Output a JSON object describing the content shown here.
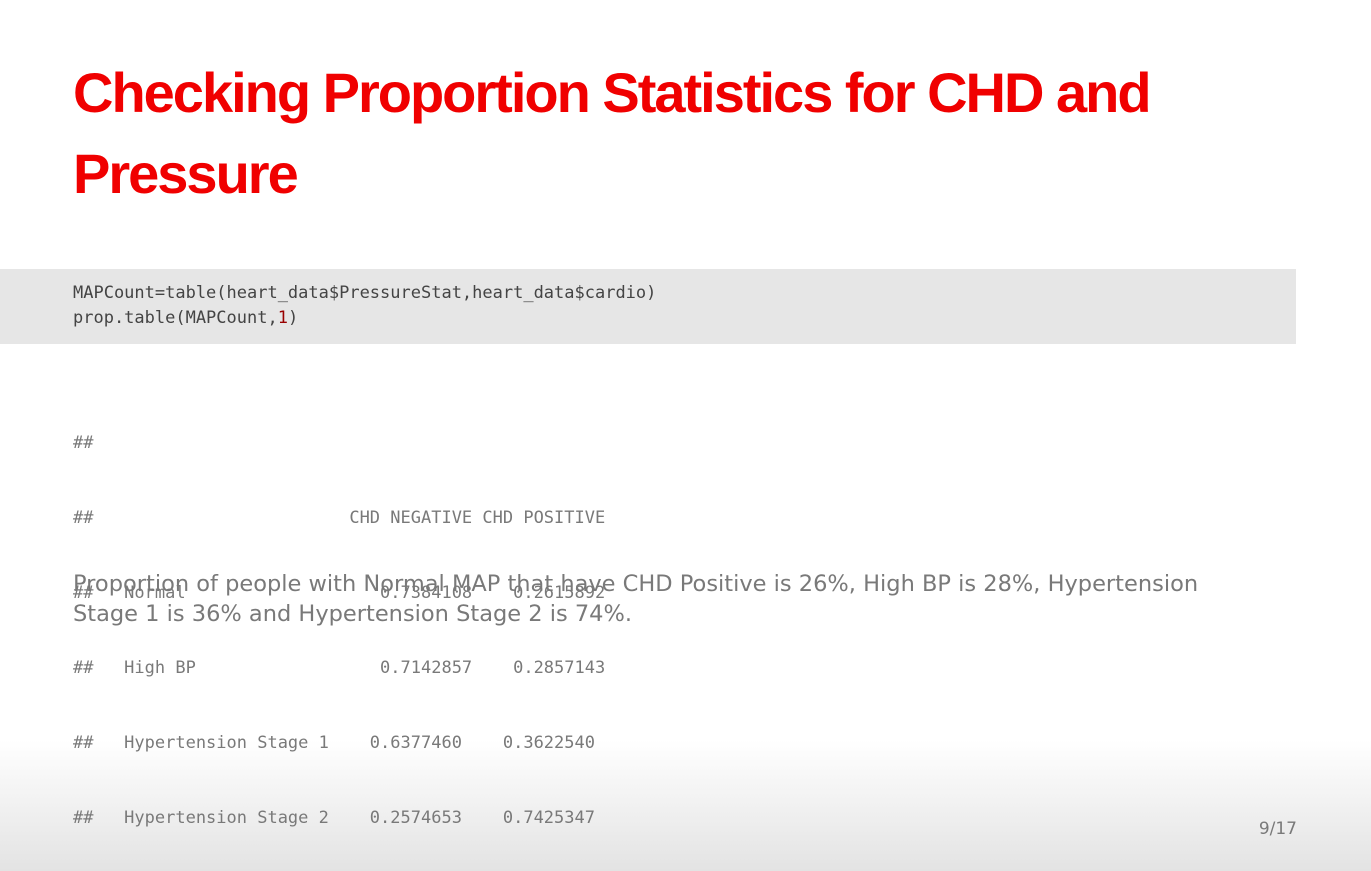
{
  "slide": {
    "title": "Checking Proportion Statistics for CHD and Pressure",
    "code": {
      "line1": "MAPCount=table(heart_data$PressureStat,heart_data$cardio)",
      "line2_prefix": "prop.table(MAPCount,",
      "line2_number": "1",
      "line2_suffix": ")"
    },
    "output": {
      "blank_line": "##",
      "header": "##                         CHD NEGATIVE CHD POSITIVE",
      "rows": [
        "##   Normal                   0.7384108    0.2615892",
        "##   High BP                  0.7142857    0.2857143",
        "##   Hypertension Stage 1    0.6377460    0.3622540",
        "##   Hypertension Stage 2    0.2574653    0.7425347"
      ]
    },
    "paragraph": "Proportion of people with Normal MAP that have CHD Positive is 26%, High BP is 28%, Hypertension Stage 1 is 36% and Hypertension Stage 2 is 74%.",
    "slide_number": "9/17"
  },
  "colors": {
    "title": "#f00000",
    "code_background": "#e6e6e6",
    "code_text": "#444444",
    "code_number": "#990000",
    "body_text": "#797979"
  }
}
